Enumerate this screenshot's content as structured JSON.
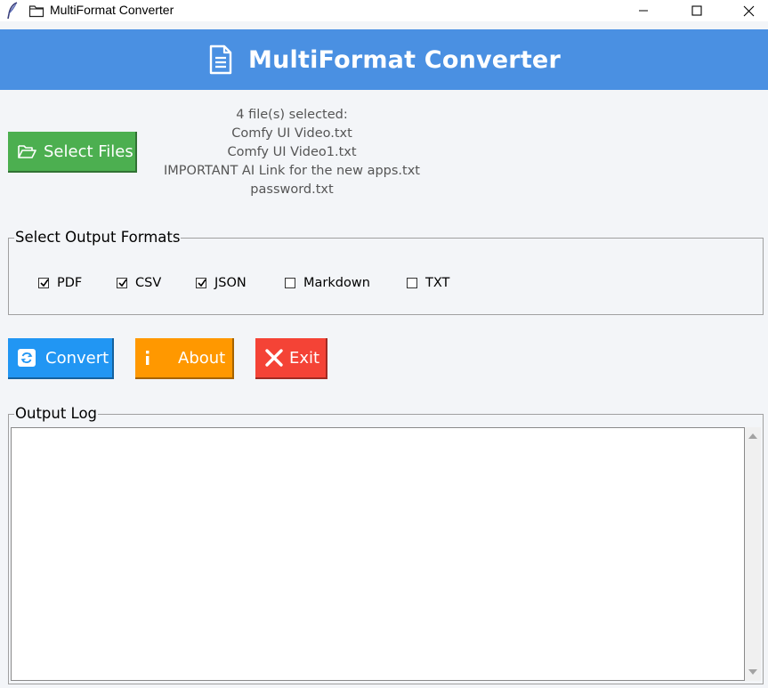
{
  "window": {
    "title": "MultiFormat Converter",
    "feather_icon": "feather-icon",
    "folder_icon": "folder-icon",
    "controls": [
      "minimize-icon",
      "maximize-icon",
      "close-icon"
    ]
  },
  "header": {
    "title": "MultiFormat Converter",
    "icon": "document-icon",
    "background": "#4a90e2"
  },
  "select_files": {
    "label": "Select Files",
    "icon": "open-folder-icon",
    "color": "#4caf50"
  },
  "files_info": {
    "summary": "4 file(s) selected:",
    "files": [
      "Comfy UI Video.txt",
      "Comfy UI Video1.txt",
      "IMPORTANT AI Link for the new apps.txt",
      "password.txt"
    ]
  },
  "formats": {
    "legend": "Select Output Formats",
    "options": [
      {
        "label": "PDF",
        "checked": true
      },
      {
        "label": "CSV",
        "checked": true
      },
      {
        "label": "JSON",
        "checked": true
      },
      {
        "label": "Markdown",
        "checked": false
      },
      {
        "label": "TXT",
        "checked": false
      }
    ]
  },
  "actions": {
    "convert": {
      "label": "Convert",
      "icon": "refresh-icon",
      "color": "#2196f3"
    },
    "about": {
      "label": "About",
      "icon": "info-icon",
      "color": "#ff9800"
    },
    "exit": {
      "label": "Exit",
      "icon": "x-icon",
      "color": "#f44336"
    }
  },
  "output_log": {
    "legend": "Output Log",
    "content": ""
  }
}
